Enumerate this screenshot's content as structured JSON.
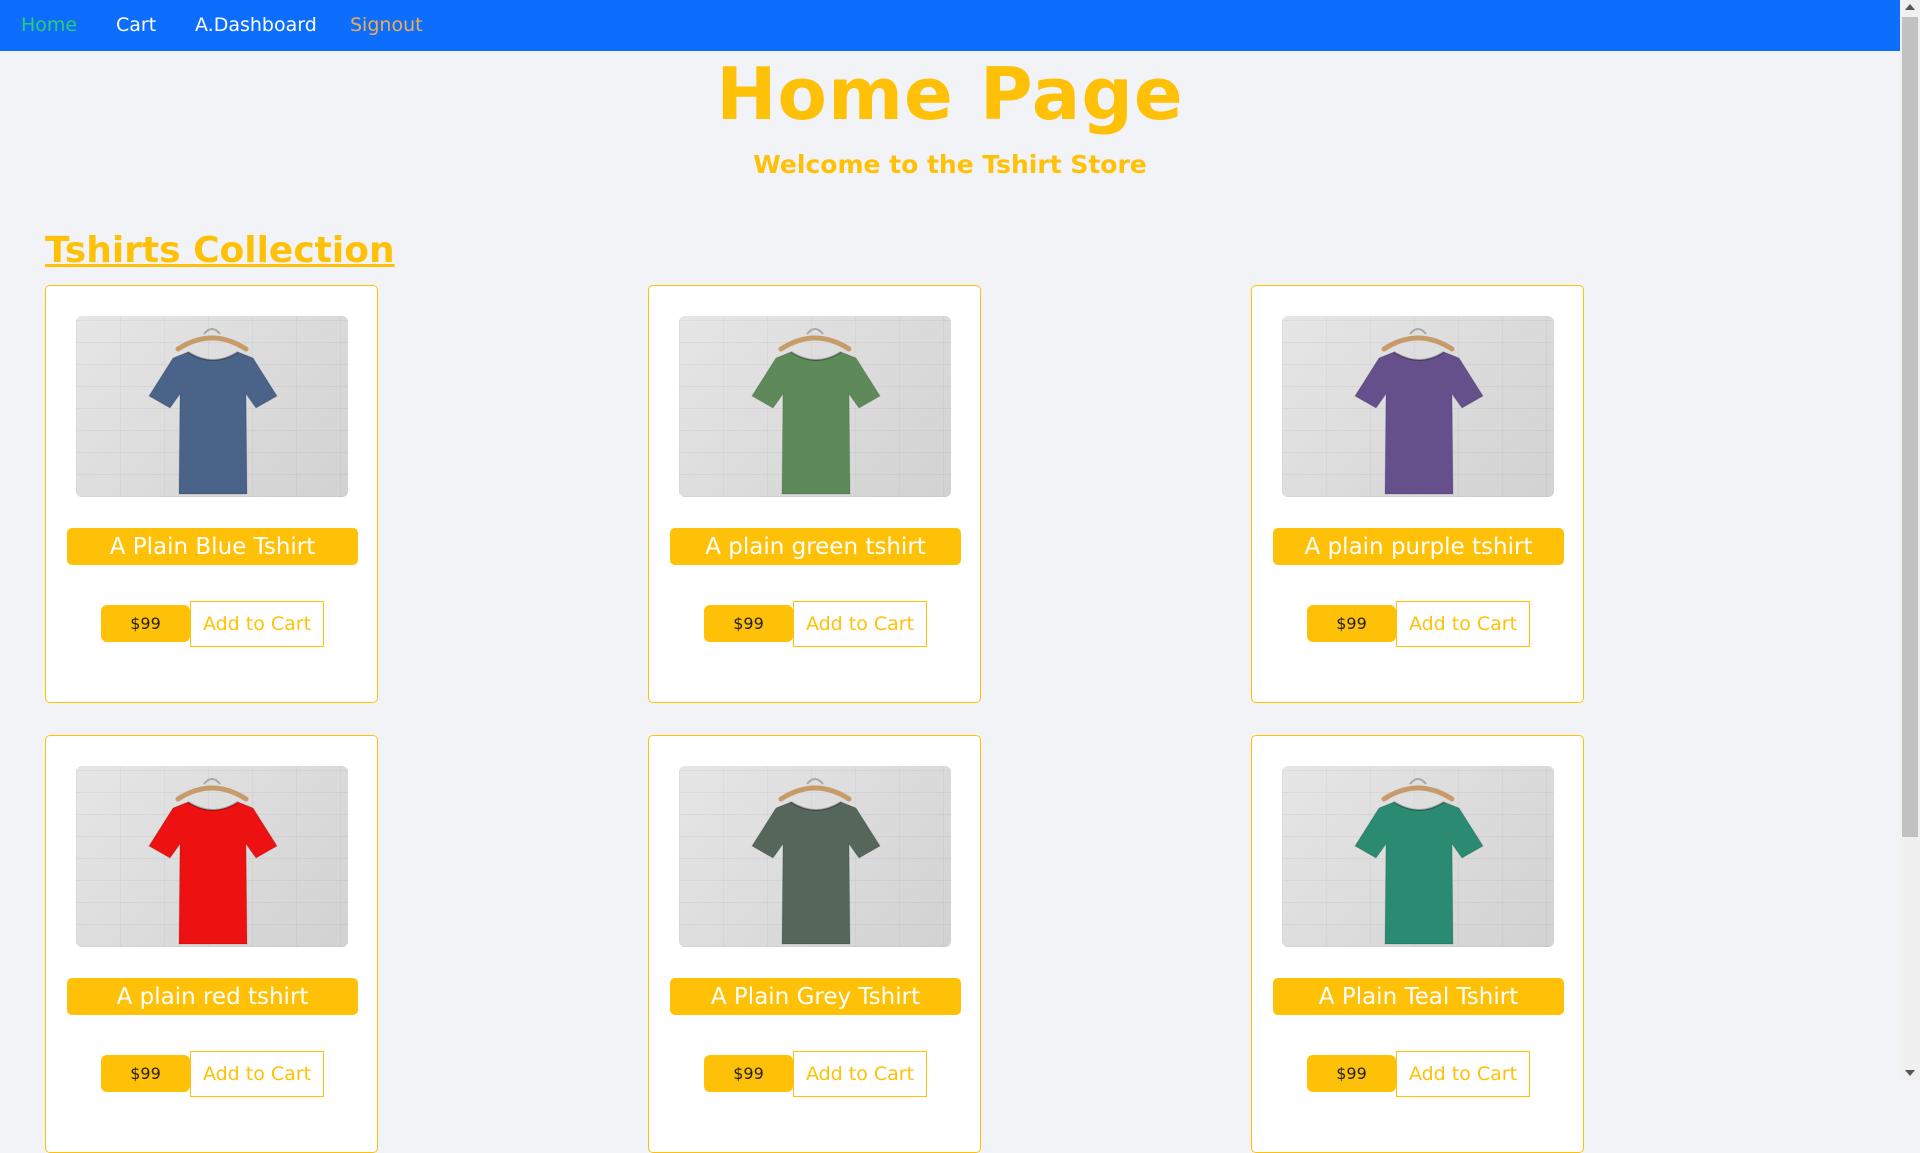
{
  "nav": {
    "home": "Home",
    "cart": "Cart",
    "dashboard": "A.Dashboard",
    "signout": "Signout"
  },
  "header": {
    "title": "Home Page",
    "subtitle": "Welcome to the Tshirt Store"
  },
  "section": {
    "title": "Tshirts Collection"
  },
  "products": [
    {
      "name": "A Plain Blue Tshirt",
      "price": "$99",
      "cta": "Add to Cart",
      "shirt_color": "#4a6388"
    },
    {
      "name": "A plain green tshirt",
      "price": "$99",
      "cta": "Add to Cart",
      "shirt_color": "#5e8a5a"
    },
    {
      "name": "A plain purple tshirt",
      "price": "$99",
      "cta": "Add to Cart",
      "shirt_color": "#65508c"
    },
    {
      "name": "A plain red tshirt",
      "price": "$99",
      "cta": "Add to Cart",
      "shirt_color": "#ee1111"
    },
    {
      "name": "A Plain Grey Tshirt",
      "price": "$99",
      "cta": "Add to Cart",
      "shirt_color": "#55665a"
    },
    {
      "name": "A Plain Teal Tshirt",
      "price": "$99",
      "cta": "Add to Cart",
      "shirt_color": "#2b8a72"
    }
  ],
  "colors": {
    "navbar": "#0d6efd",
    "accent": "#ffc107",
    "home_link": "#2ecc71",
    "signout_link": "#f0ad4e",
    "background": "#f1f3f7"
  }
}
